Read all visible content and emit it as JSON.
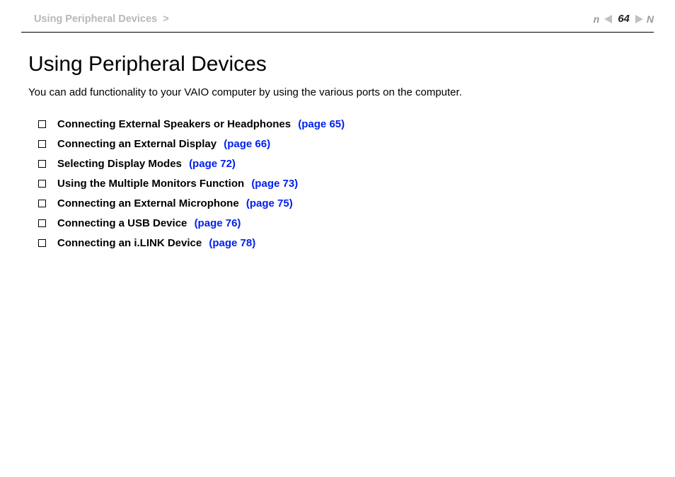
{
  "header": {
    "breadcrumb": "Using Peripheral Devices",
    "breadcrumb_sep": ">",
    "page_number": "64",
    "nav_n_left": "n",
    "nav_n_right": "N"
  },
  "content": {
    "title": "Using Peripheral Devices",
    "intro": "You can add functionality to your VAIO computer by using the various ports on the computer.",
    "toc": [
      {
        "title": "Connecting External Speakers or Headphones",
        "ref": "(page 65)"
      },
      {
        "title": "Connecting an External Display",
        "ref": "(page 66)"
      },
      {
        "title": "Selecting Display Modes",
        "ref": "(page 72)"
      },
      {
        "title": "Using the Multiple Monitors Function",
        "ref": "(page 73)"
      },
      {
        "title": "Connecting an External Microphone",
        "ref": "(page 75)"
      },
      {
        "title": "Connecting a USB Device",
        "ref": "(page 76)"
      },
      {
        "title": "Connecting an i.LINK Device",
        "ref": "(page 78)"
      }
    ]
  }
}
